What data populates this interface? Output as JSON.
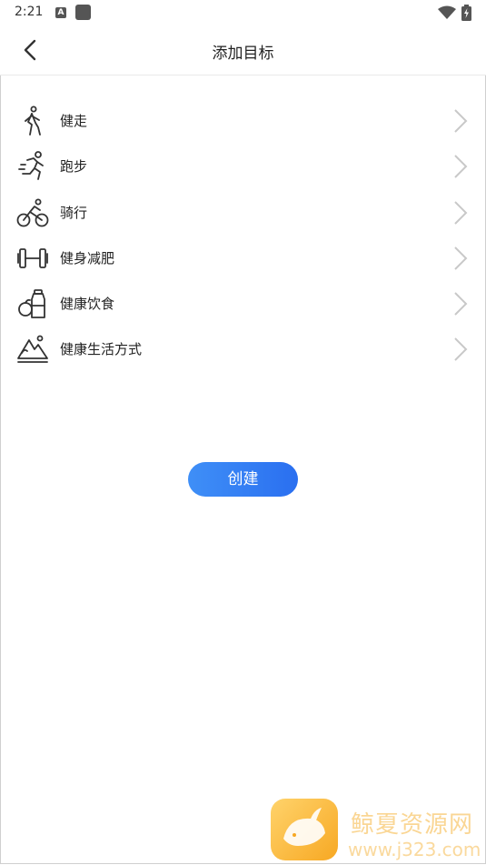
{
  "status_bar": {
    "time": "2:21",
    "a_icon": "A"
  },
  "header": {
    "title": "添加目标",
    "back_icon": "chevron-left-icon"
  },
  "goals": [
    {
      "label": "健走",
      "icon": "walking-icon"
    },
    {
      "label": "跑步",
      "icon": "running-icon"
    },
    {
      "label": "骑行",
      "icon": "cycling-icon"
    },
    {
      "label": "健身减肥",
      "icon": "dumbbell-icon"
    },
    {
      "label": "健康饮食",
      "icon": "healthy-food-icon"
    },
    {
      "label": "健康生活方式",
      "icon": "lifestyle-icon"
    }
  ],
  "create_button": {
    "label": "创建"
  },
  "watermark": {
    "text": "鲸夏资源网",
    "url": "www.j323.com"
  },
  "colors": {
    "accent": "#3a86f5",
    "text": "#222222",
    "chevron": "#c8c8c8",
    "watermark": "#f5b43c"
  }
}
